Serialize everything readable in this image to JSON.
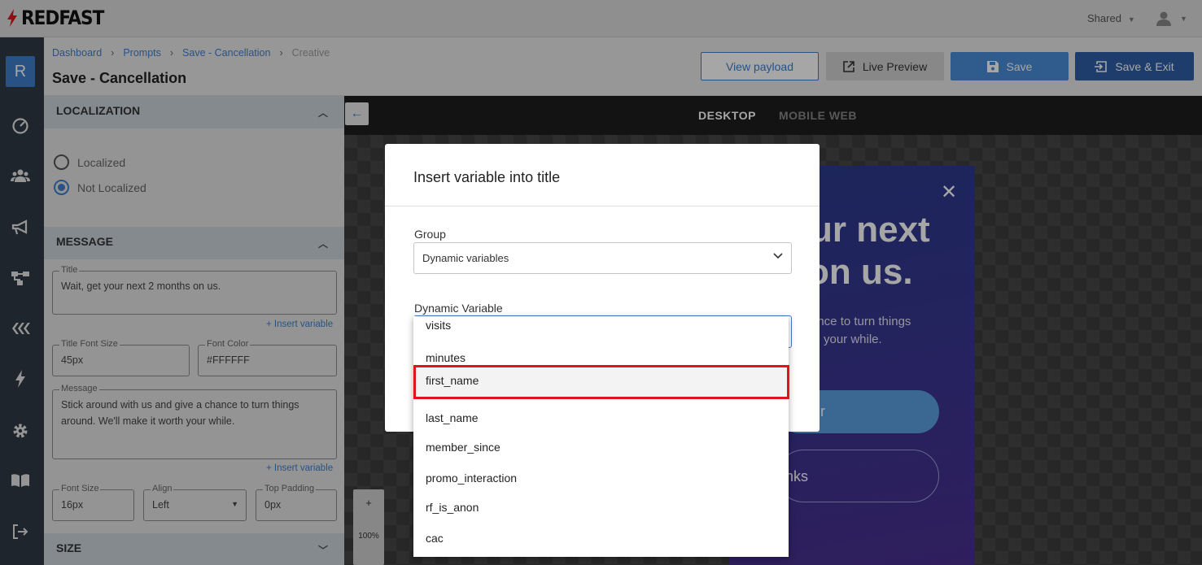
{
  "app": {
    "logo_text": "REDFAST",
    "shared_label": "Shared"
  },
  "breadcrumb": [
    {
      "label": "Dashboard"
    },
    {
      "label": "Prompts"
    },
    {
      "label": "Save - Cancellation"
    },
    {
      "label": "Creative"
    }
  ],
  "page_title": "Save - Cancellation",
  "rail": {
    "avatar_letter": "R"
  },
  "header_buttons": {
    "view_payload": "View payload",
    "live_preview": "Live Preview",
    "save": "Save",
    "save_exit": "Save & Exit"
  },
  "panel": {
    "localization": {
      "title": "LOCALIZATION",
      "options": [
        "Localized",
        "Not Localized"
      ],
      "selected": "Not Localized"
    },
    "message": {
      "title": "MESSAGE",
      "title_field": {
        "label": "Title",
        "value": "Wait, get your next 2 months on us."
      },
      "insert_variable": "+ Insert variable",
      "title_font_size": {
        "label": "Title Font Size",
        "value": "45px"
      },
      "font_color": {
        "label": "Font Color",
        "value": "#FFFFFF"
      },
      "message_field": {
        "label": "Message",
        "value": "Stick around with us and give a chance to turn things around. We'll make it worth your while."
      },
      "font_size": {
        "label": "Font Size",
        "value": "16px"
      },
      "align": {
        "label": "Align",
        "value": "Left"
      },
      "top_padding": {
        "label": "Top Padding",
        "value": "0px"
      }
    },
    "size": {
      "title": "SIZE"
    }
  },
  "canvas": {
    "tabs": [
      "DESKTOP",
      "MOBILE WEB"
    ],
    "active_tab": "DESKTOP",
    "preview": {
      "title_line1": "ur next",
      "title_line2": "on us.",
      "body_line1": "ance to turn things",
      "body_line2": "your while.",
      "button1": "r",
      "button2": "nks"
    },
    "zoom_plus": "+",
    "zoom_level": "100%"
  },
  "dialog": {
    "title": "Insert variable into title",
    "group_label": "Group",
    "group_value": "Dynamic variables",
    "variable_label": "Dynamic Variable",
    "options": [
      "visits",
      "minutes",
      "first_name",
      "last_name",
      "member_since",
      "promo_interaction",
      "rf_is_anon",
      "cac"
    ],
    "highlighted": "first_name"
  },
  "colors": {
    "accent": "#3f7ecb",
    "rail": "#2e3a44",
    "highlight_box": "#e0141e"
  }
}
